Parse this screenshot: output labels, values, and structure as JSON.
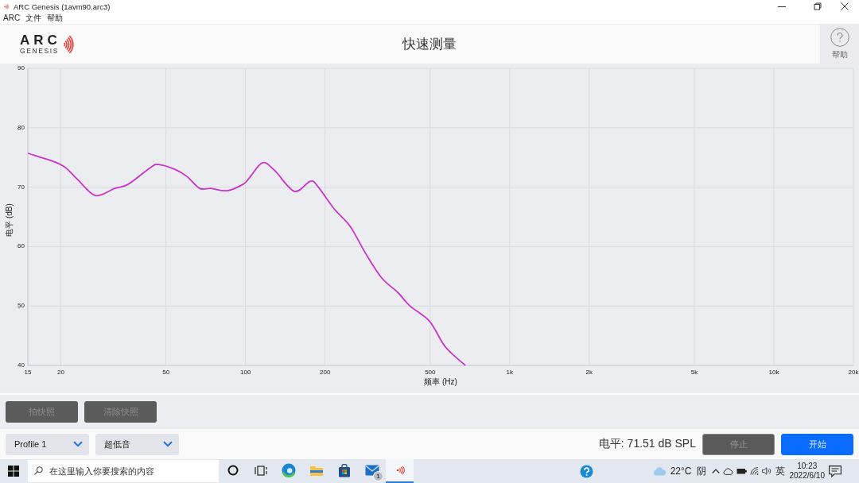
{
  "window": {
    "title": "ARC Genesis (1avm90.arc3)"
  },
  "menu": [
    "ARC",
    "文件",
    "帮助"
  ],
  "header": {
    "logo": {
      "name": "ARC",
      "subtitle": "GENESIS"
    },
    "title": "快速测量",
    "help_label": "帮助"
  },
  "chart": {
    "chart_data": {
      "type": "line",
      "xlabel": "频率 (Hz)",
      "ylabel": "电平 (dB)",
      "log": "x",
      "grid": true,
      "x": [
        15,
        20,
        23,
        27,
        32,
        36,
        44,
        47,
        54,
        60,
        67,
        74,
        85,
        98,
        104,
        116,
        129,
        153,
        176,
        188,
        217,
        249,
        286,
        328,
        377,
        419,
        498,
        571,
        680
      ],
      "series": [
        {
          "color": "#c935c9",
          "values": [
            75.7,
            73.8,
            71.4,
            68.6,
            69.8,
            70.5,
            73.4,
            73.8,
            73.0,
            71.8,
            69.8,
            69.8,
            69.4,
            70.5,
            71.7,
            74.1,
            72.8,
            69.3,
            71.0,
            70.1,
            66.3,
            63.4,
            58.7,
            54.7,
            52.3,
            50.0,
            47.4,
            43.1,
            40.0
          ]
        }
      ],
      "xlim": [
        15,
        20000
      ],
      "ylim": [
        40,
        90
      ],
      "xticks": [
        15,
        20,
        50,
        100,
        200,
        500,
        {
          "value": 1000,
          "label": "1k"
        },
        {
          "value": 2000,
          "label": "2k"
        },
        {
          "value": 5000,
          "label": "5k"
        },
        {
          "value": 10000,
          "label": "10k"
        },
        {
          "value": 20000,
          "label": "20k"
        }
      ],
      "yticks": [
        40,
        50,
        60,
        70,
        80,
        90
      ]
    }
  },
  "snapshot_buttons": [
    {
      "label": "拍快照",
      "disabled": true
    },
    {
      "label": "清除快照",
      "disabled": true
    }
  ],
  "bottom_bar": {
    "dropdowns": [
      {
        "value": "Profile 1"
      },
      {
        "value": "超低音"
      }
    ],
    "level_reading": "电平: 71.51 dB SPL",
    "buttons": [
      {
        "label": "停止",
        "kind": "secondary",
        "disabled": true
      },
      {
        "label": "开始",
        "kind": "primary",
        "disabled": false
      }
    ]
  },
  "taskbar": {
    "search": {
      "placeholder": "在这里输入你要搜索的内容"
    },
    "apps": [
      {
        "kind": "cortana",
        "active": false
      },
      {
        "kind": "task-view",
        "active": false
      },
      {
        "kind": "browser",
        "active": false
      },
      {
        "kind": "folder",
        "active": false
      },
      {
        "kind": "store",
        "active": false
      },
      {
        "kind": "mail",
        "active": false,
        "badge": "1"
      },
      {
        "kind": "arc",
        "active": true
      }
    ],
    "tray": {
      "weather": {
        "temperature": "22°C",
        "condition": "阴"
      },
      "input_language": "英",
      "time": "10:23",
      "date": "2022/6/10"
    }
  }
}
